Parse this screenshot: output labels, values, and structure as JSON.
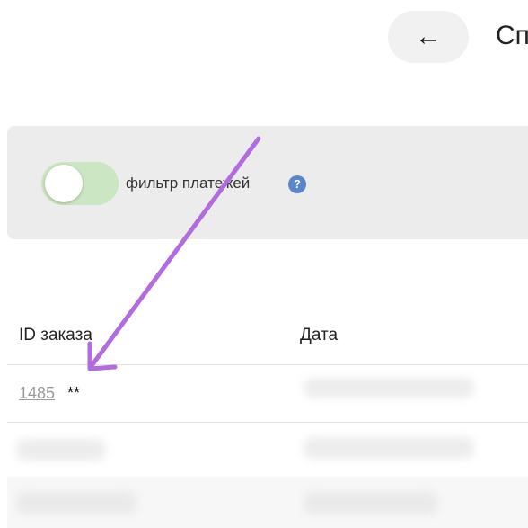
{
  "header": {
    "back_icon": "←",
    "title_partial": "Сп"
  },
  "filter": {
    "label": "фильтр платежей",
    "help_icon": "?",
    "toggle_on": false
  },
  "table": {
    "columns": [
      "ID заказа",
      "Дата"
    ],
    "rows": [
      {
        "order_id": "1485",
        "suffix": "**"
      }
    ]
  },
  "annotation": {
    "arrow_color": "#b36be0",
    "arrow_icon": "arrow-pointer-icon"
  }
}
